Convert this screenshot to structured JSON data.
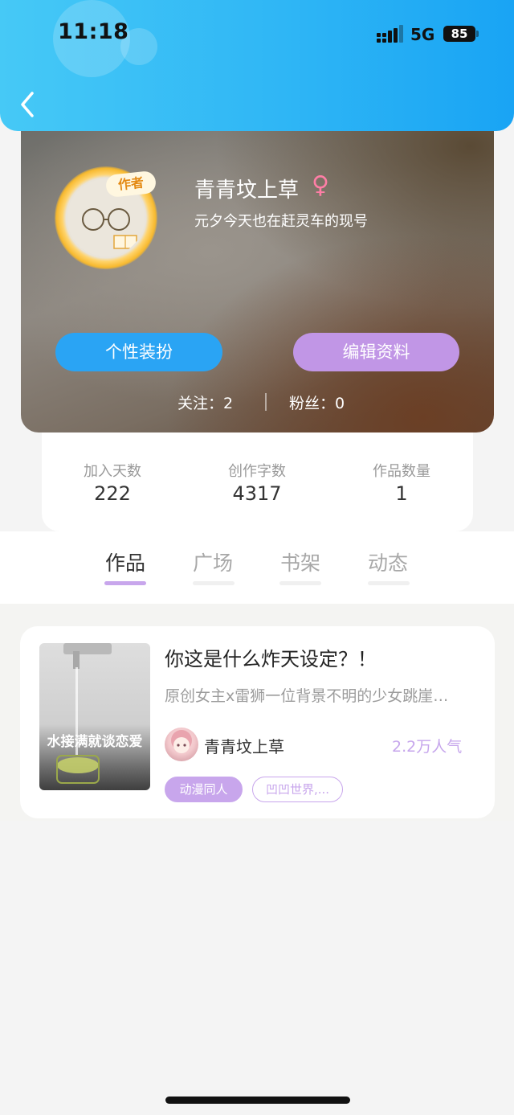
{
  "status_bar": {
    "time": "11:18",
    "network": "5G",
    "battery": "85"
  },
  "profile": {
    "author_badge": "作者",
    "name": "青青坟上草",
    "gender_symbol": "♀",
    "bio": "元夕今天也在赶灵车的现号",
    "buttons": {
      "dress_up": "个性装扮",
      "edit_profile": "编辑资料"
    },
    "following": "关注：2",
    "fans": "粉丝：0"
  },
  "stats": [
    {
      "label": "加入天数",
      "value": "222"
    },
    {
      "label": "创作字数",
      "value": "4317"
    },
    {
      "label": "作品数量",
      "value": "1"
    }
  ],
  "tabs": [
    {
      "label": "作品",
      "active": true
    },
    {
      "label": "广场",
      "active": false
    },
    {
      "label": "书架",
      "active": false
    },
    {
      "label": "动态",
      "active": false
    }
  ],
  "work": {
    "cover_text": "水接满就谈恋爱",
    "title": "你这是什么炸天设定？！",
    "description": "原创女主x雷狮一位背景不明的少女跳崖…",
    "author": "青青坟上草",
    "popularity": "2.2万人气",
    "tags": [
      "动漫同人",
      "凹凹世界,..."
    ]
  },
  "colors": {
    "header_blue": "#2fb6f5",
    "accent_purple": "#c8a6ec",
    "button_blue": "#2aa4f4"
  }
}
